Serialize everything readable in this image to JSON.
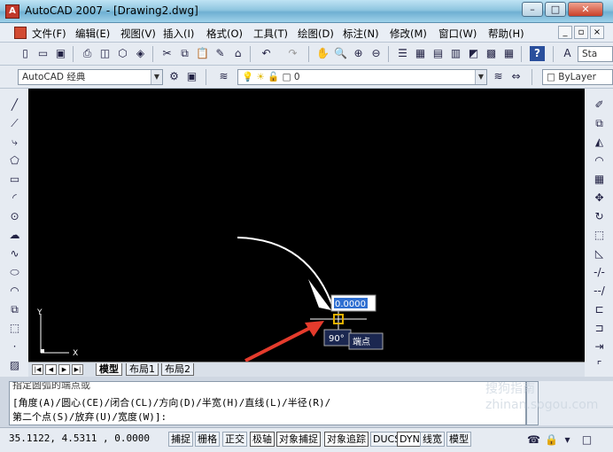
{
  "window": {
    "title": "AutoCAD 2007 - [Drawing2.dwg]",
    "app_icon": "A"
  },
  "menu": {
    "items": [
      "文件(F)",
      "编辑(E)",
      "视图(V)",
      "插入(I)",
      "格式(O)",
      "工具(T)",
      "绘图(D)",
      "标注(N)",
      "修改(M)",
      "窗口(W)",
      "帮助(H)"
    ]
  },
  "workspace": {
    "value": "AutoCAD 经典"
  },
  "layer": {
    "value": "0"
  },
  "linetype": {
    "value": "ByLayer"
  },
  "text_style": {
    "value": "Sta"
  },
  "canvas": {
    "ucs": {
      "x_label": "X",
      "y_label": "Y"
    },
    "dyn_input_value": "0.0000",
    "angle_label": "90°",
    "tooltip": "端点",
    "colors": {
      "background": "#000000",
      "arrow": "#e53b2c",
      "input_bg": "#ffffff",
      "input_selected": "#2f6fd1"
    }
  },
  "layout_tabs": [
    "模型",
    "布局1",
    "布局2"
  ],
  "command": {
    "line1": "指定圆弧的端点或",
    "line2": "[角度(A)/圆心(CE)/闭合(CL)/方向(D)/半宽(H)/直线(L)/半径(R)/",
    "line3": "第二个点(S)/放弃(U)/宽度(W)]:"
  },
  "status": {
    "coords": "35.1122, 4.5311 , 0.0000",
    "buttons": [
      "捕捉",
      "栅格",
      "正交",
      "极轴",
      "对象捕捉",
      "对象追踪",
      "DUCS",
      "DYN",
      "线宽",
      "模型"
    ]
  },
  "watermark": "搜狗指南 zhinan.sogou.com"
}
